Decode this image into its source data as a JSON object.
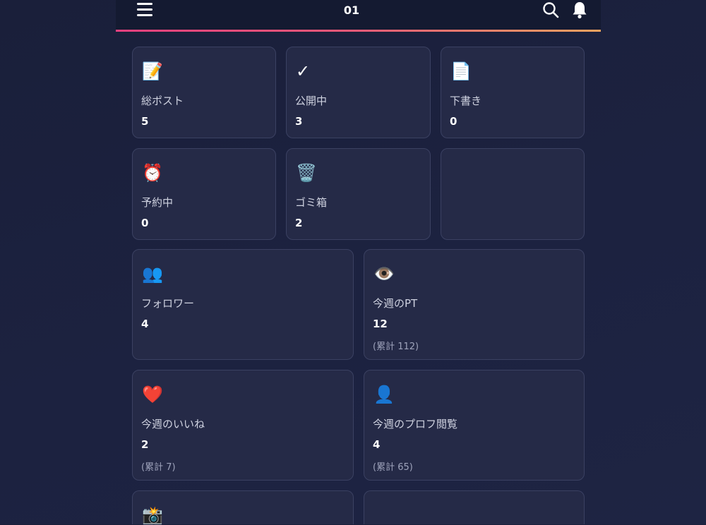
{
  "header": {
    "title": "01",
    "menu_icon": "menu-icon",
    "search_icon": "search-icon",
    "bell_icon": "bell-icon",
    "accent_colors": [
      "#e8407e",
      "#f3a35f"
    ]
  },
  "stats_top": [
    {
      "icon": "📝",
      "icon_name": "memo-icon",
      "label": "総ポスト",
      "value": "5"
    },
    {
      "icon": "✓",
      "icon_name": "check-icon",
      "label": "公開中",
      "value": "3"
    },
    {
      "icon": "📄",
      "icon_name": "document-icon",
      "label": "下書き",
      "value": "0"
    },
    {
      "icon": "⏰",
      "icon_name": "alarm-clock-icon",
      "label": "予約中",
      "value": "0"
    },
    {
      "icon": "🗑️",
      "icon_name": "trash-icon",
      "label": "ゴミ箱",
      "value": "2"
    }
  ],
  "stats_weekly": [
    {
      "icon": "👥",
      "icon_name": "users-icon",
      "label": "フォロワー",
      "value": "4"
    },
    {
      "icon": "👁️",
      "icon_name": "eye-icon",
      "label": "今週のPT",
      "value": "12",
      "total_prefix": "(累計 ",
      "total": "112",
      "total_suffix": ")"
    },
    {
      "icon": "❤️",
      "icon_name": "heart-icon",
      "label": "今週のいいね",
      "value": "2",
      "total_prefix": "(累計 ",
      "total": "7",
      "total_suffix": ")"
    },
    {
      "icon": "👤",
      "icon_name": "user-icon",
      "label": "今週のプロフ閲覧",
      "value": "4",
      "total_prefix": "(累計 ",
      "total": "65",
      "total_suffix": ")"
    },
    {
      "icon": "📸",
      "icon_name": "camera-flash-icon"
    }
  ]
}
